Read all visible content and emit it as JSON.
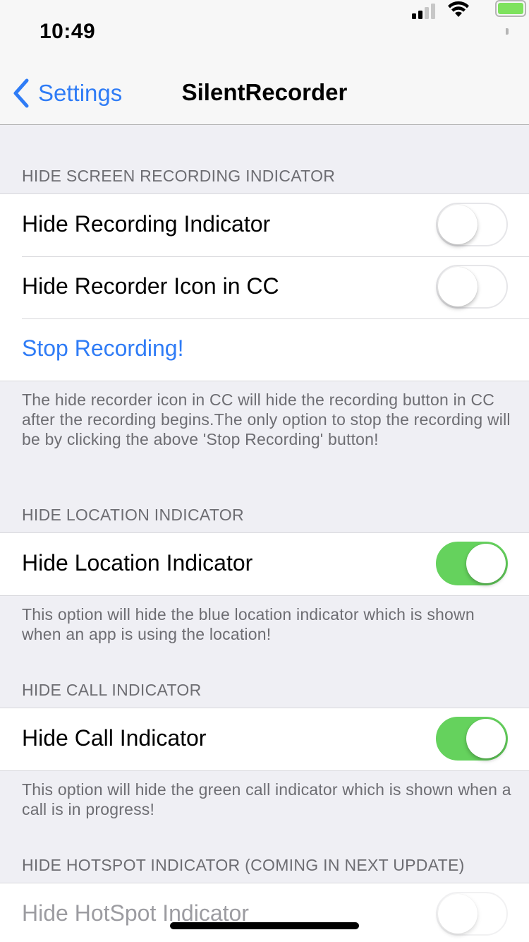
{
  "status_bar": {
    "time": "10:49",
    "signal_icon": "cellular-signal-icon",
    "wifi_icon": "wifi-icon",
    "battery_icon": "battery-icon",
    "battery_color": "#7ee25e"
  },
  "nav": {
    "back_label": "Settings",
    "back_icon": "chevron-left-icon",
    "title": "SilentRecorder",
    "accent_color": "#2f7cf6"
  },
  "sections": {
    "screen_recording": {
      "header": "HIDE SCREEN RECORDING INDICATOR",
      "rows": [
        {
          "label": "Hide Recording Indicator",
          "toggle": false
        },
        {
          "label": "Hide Recorder Icon in CC",
          "toggle": false
        },
        {
          "label": "Stop Recording!"
        }
      ],
      "footer": "The hide recorder icon in CC will hide the recording button in CC after the recording begins.The only option to stop the recording will be by clicking the above 'Stop Recording' button!"
    },
    "location": {
      "header": "HIDE LOCATION INDICATOR",
      "rows": [
        {
          "label": "Hide Location Indicator",
          "toggle": true
        }
      ],
      "footer": "This option will hide the blue location indicator which is shown when an app is using the location!"
    },
    "call": {
      "header": "HIDE CALL INDICATOR",
      "rows": [
        {
          "label": "Hide Call Indicator",
          "toggle": true
        }
      ],
      "footer": "This option will hide the green call indicator which is shown when a call is in progress!"
    },
    "hotspot": {
      "header": "HIDE HOTSPOT INDICATOR (COMING IN NEXT UPDATE)",
      "rows": [
        {
          "label": "Hide HotSpot Indicator",
          "toggle": false,
          "disabled": true
        }
      ]
    }
  },
  "colors": {
    "toggle_on": "#65d25d",
    "background": "#efeff4"
  }
}
